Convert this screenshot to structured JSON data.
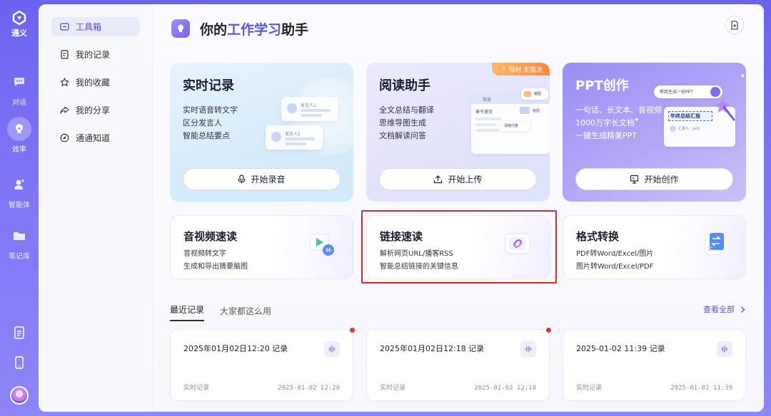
{
  "rail": {
    "logo_label": "通义",
    "items": [
      {
        "label": "对话",
        "icon": "chat-icon"
      },
      {
        "label": "效率",
        "icon": "bulb-icon",
        "active": true
      },
      {
        "label": "智能体",
        "icon": "agent-icon"
      },
      {
        "label": "笔记库",
        "icon": "folder-icon"
      }
    ],
    "bottom_icons": [
      "document-icon",
      "tablet-icon",
      "avatar"
    ]
  },
  "sidebar": {
    "items": [
      {
        "label": "工具箱",
        "icon": "toolbox-icon",
        "active": true
      },
      {
        "label": "我的记录",
        "icon": "record-icon"
      },
      {
        "label": "我的收藏",
        "icon": "star-icon"
      },
      {
        "label": "我的分享",
        "icon": "share-icon"
      },
      {
        "label": "通通知道",
        "icon": "compass-icon"
      }
    ]
  },
  "header": {
    "title_prefix": "你的",
    "title_highlight": "工作学习",
    "title_suffix": "助手"
  },
  "big_cards": [
    {
      "title": "实时记录",
      "lines": [
        "实时语音转文字",
        "区分发言人",
        "智能总结要点"
      ],
      "button": "开始录音",
      "illus": {
        "speaker1": "发言人1",
        "speaker2": "发言人2"
      }
    },
    {
      "title": "阅读助手",
      "lines": [
        "全文总结与翻译",
        "思维导图生成",
        "文档解读问答"
      ],
      "button": "开始上传",
      "tag": "限时 无限次",
      "illus": {
        "nav": "导读",
        "outline": "章节速览",
        "map": "脑图",
        "node": "深度问答",
        "branch": "脑图"
      }
    },
    {
      "title": "PPT创作",
      "lines": [
        "一句话、长文本、音视频",
        "1000万字长文档",
        "一键生成精美PPT"
      ],
      "button": "开始创作",
      "illus": {
        "prompt": "帮我生成一份PPT",
        "slide_title": "年终总结汇报",
        "reporter": "汇报人：Jack"
      }
    }
  ],
  "small_cards": [
    {
      "title": "音视频速读",
      "lines": [
        "音视频转文字",
        "生成和导出摘要脑图"
      ]
    },
    {
      "title": "链接速读",
      "lines": [
        "解析网页URL/播客RSS",
        "智能总结链接的关键信息"
      ]
    },
    {
      "title": "格式转换",
      "lines": [
        "PDF转Word/Excel/图片",
        "图片转Word/Excel/PDF"
      ]
    }
  ],
  "recent": {
    "tabs": [
      "最近记录",
      "大家都这么用"
    ],
    "view_all": "查看全部",
    "records": [
      {
        "title": "2025年01月02日12:20 记录",
        "type": "实时记录",
        "date": "2025-01-02 12:20",
        "unread": true
      },
      {
        "title": "2025年01月02日12:18 记录",
        "type": "实时记录",
        "date": "2025-01-02 12:18",
        "unread": true
      },
      {
        "title": "2025-01-02 11:39 记录",
        "type": "实时记录",
        "date": "2025-01-02 11:39",
        "unread": false
      }
    ]
  },
  "colors": {
    "accent": "#5a55e8",
    "rail": "#6b63f0",
    "highlight_box": "#e0282b",
    "unread_dot": "#e8303a"
  }
}
